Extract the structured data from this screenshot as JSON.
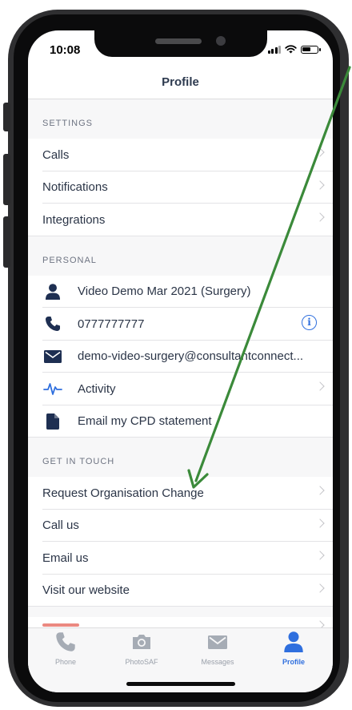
{
  "status_bar": {
    "time": "10:08"
  },
  "nav": {
    "title": "Profile"
  },
  "sections": {
    "settings": {
      "header": "SETTINGS",
      "items": [
        {
          "label": "Calls"
        },
        {
          "label": "Notifications"
        },
        {
          "label": "Integrations"
        }
      ]
    },
    "personal": {
      "header": "PERSONAL",
      "items": [
        {
          "label": "Video Demo Mar 2021 (Surgery)",
          "icon": "person-icon"
        },
        {
          "label": "0777777777",
          "icon": "phone-icon"
        },
        {
          "label": "demo-video-surgery@consultantconnect...",
          "icon": "envelope-icon"
        },
        {
          "label": "Activity",
          "icon": "activity-icon"
        },
        {
          "label": "Email my CPD statement",
          "icon": "document-icon"
        }
      ]
    },
    "get_in_touch": {
      "header": "GET IN TOUCH",
      "items": [
        {
          "label": "Request Organisation Change"
        },
        {
          "label": "Call us"
        },
        {
          "label": "Email us"
        },
        {
          "label": "Visit our website"
        }
      ]
    }
  },
  "tabbar": {
    "tabs": [
      {
        "label": "Phone",
        "icon": "phone-icon"
      },
      {
        "label": "PhotoSAF",
        "icon": "camera-icon"
      },
      {
        "label": "Messages",
        "icon": "envelope-icon"
      },
      {
        "label": "Profile",
        "icon": "person-icon",
        "active": true
      }
    ]
  },
  "colors": {
    "accent": "#2f6fde",
    "icon_dark": "#1e2f52",
    "annotation_arrow": "#3b8a3a"
  }
}
